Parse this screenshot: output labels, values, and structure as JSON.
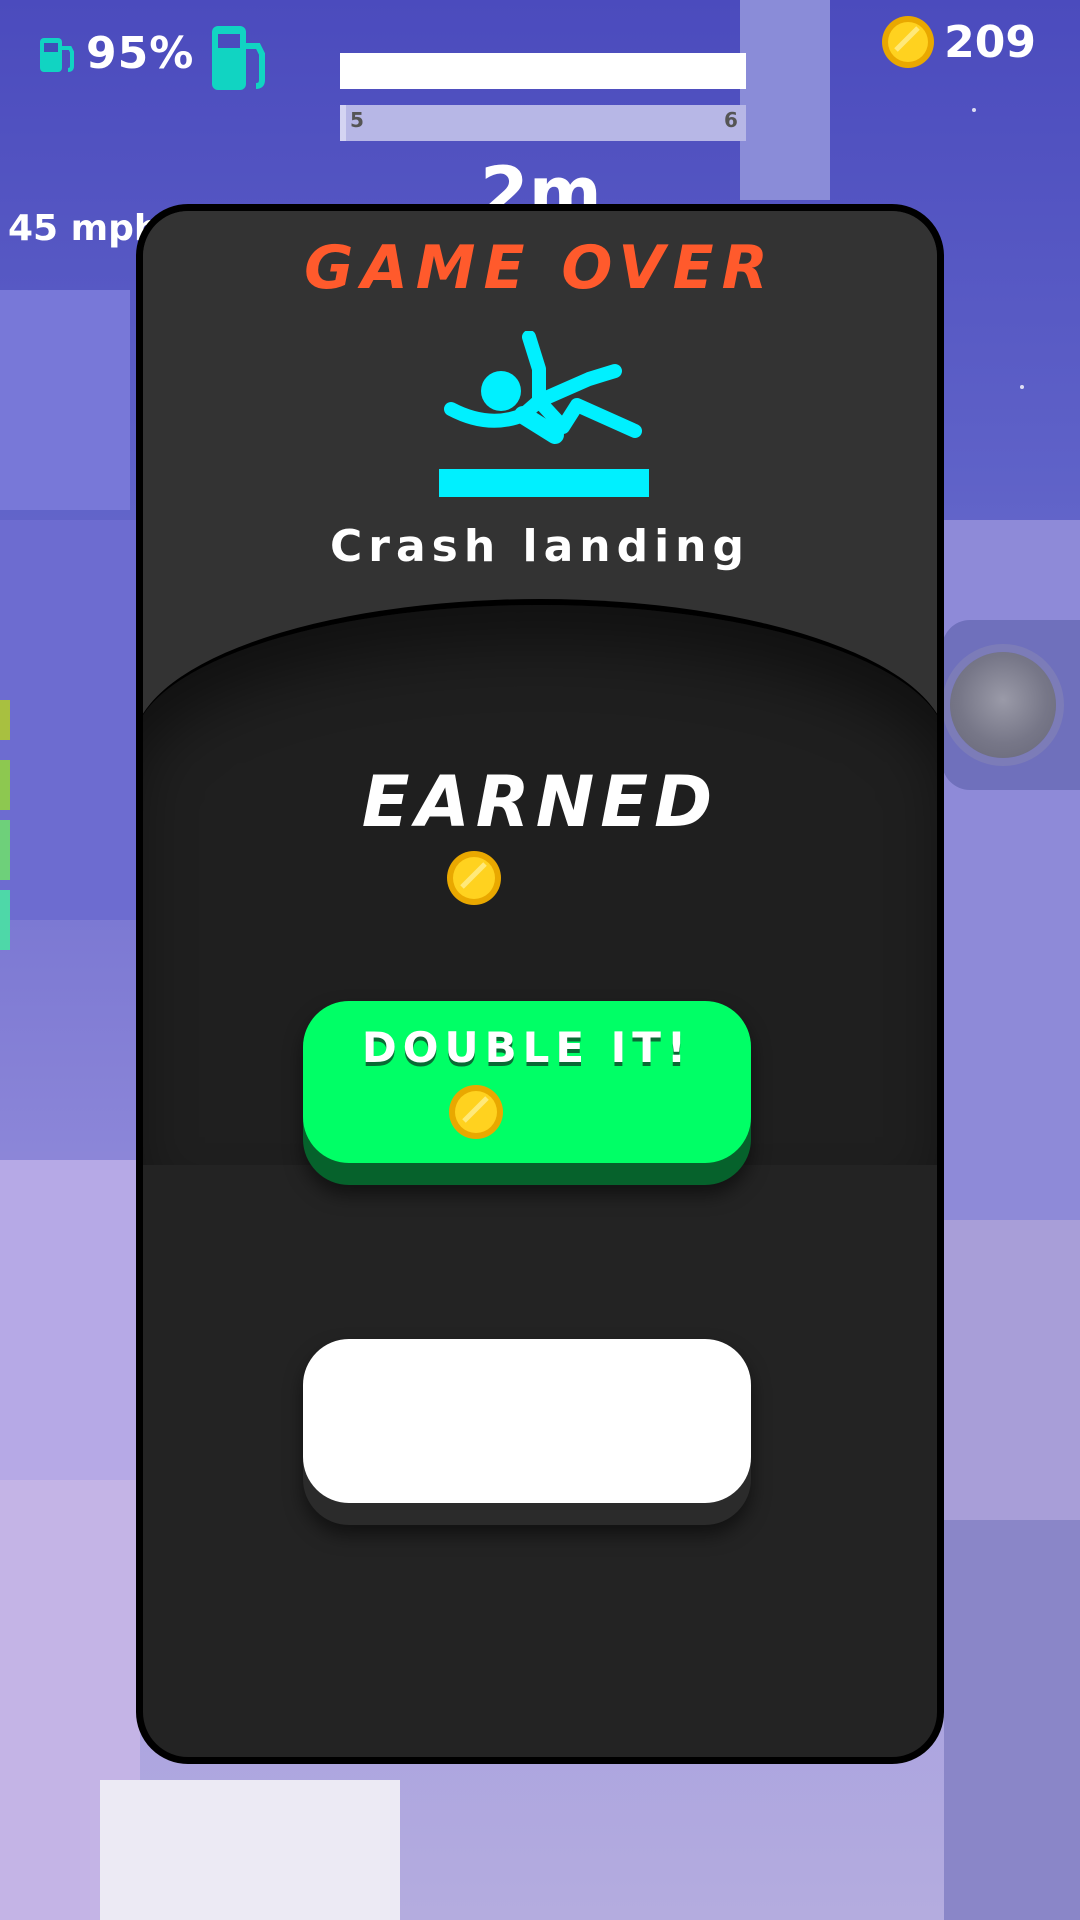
{
  "hud": {
    "fuel_percent": "95%",
    "level_start": "5",
    "level_end": "6",
    "distance": "2m",
    "speed": "45 mph",
    "coins": "209",
    "level_progress": 1.0
  },
  "modal": {
    "title": "GAME OVER",
    "reason": "Crash landing",
    "earned_label": "EARNED",
    "earned_amount": "",
    "double_button_label": "DOUBLE IT!",
    "double_amount": "",
    "continue_button_label": ""
  },
  "icons": {
    "fuel": "fuel-pump-icon",
    "coin": "coin-icon",
    "crash": "falling-person-icon"
  },
  "colors": {
    "accent_orange": "#ff5a2c",
    "cyan": "#00f0ff",
    "double_green": "#00ff66",
    "panel": "#232323"
  }
}
